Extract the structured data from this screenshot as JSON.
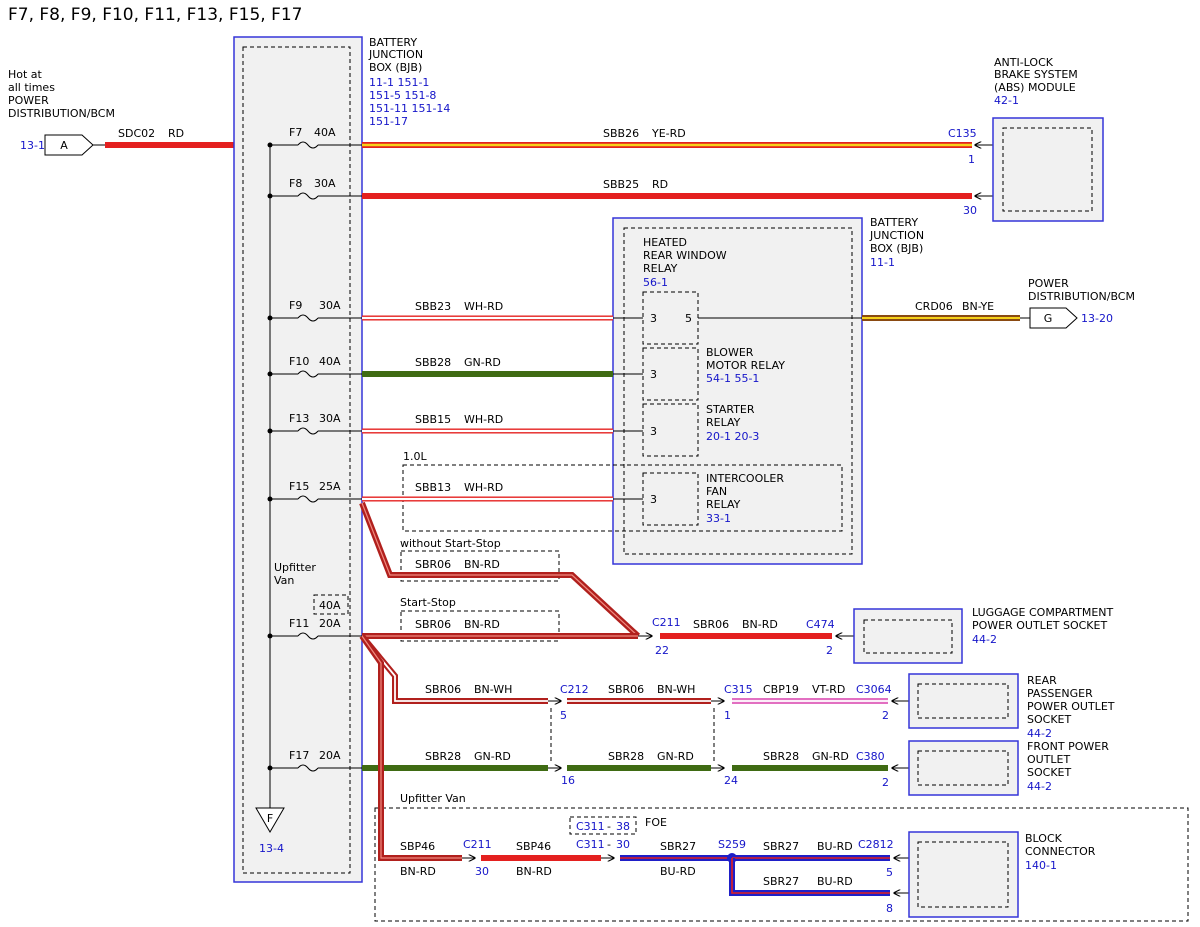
{
  "title": "F7, F8, F9, F10, F11, F13, F15, F17",
  "colors": {
    "red": "#e4201f",
    "dark_red": "#b1201d",
    "yellow": "#f6d21a",
    "green": "#3f6b13",
    "blue": "#1f1fc8",
    "violet": "#e26fc1",
    "brown": "#8a4a12",
    "box_border": "#3535d9",
    "ref_text": "#1515c9"
  },
  "source": {
    "lines": [
      "Hot at",
      "all times",
      "POWER",
      "DISTRIBUTION/BCM"
    ],
    "ref": "13-1",
    "connector": "A",
    "wire": "SDC02",
    "wire_color": "RD"
  },
  "bjb_left": {
    "lines": [
      "BATTERY",
      "JUNCTION",
      "BOX (BJB)"
    ],
    "refs": [
      "11-1    151-1",
      "151-5  151-8",
      "151-11  151-14",
      "151-17"
    ],
    "upfitter": [
      "Upfitter",
      "Van"
    ],
    "ground_label": "F",
    "ground_ref": "13-4"
  },
  "fuses": [
    {
      "name": "F7",
      "rating": "40A"
    },
    {
      "name": "F8",
      "rating": "30A"
    },
    {
      "name": "F9",
      "rating": "30A"
    },
    {
      "name": "F10",
      "rating": "40A"
    },
    {
      "name": "F13",
      "rating": "30A"
    },
    {
      "name": "F15",
      "rating": "25A"
    },
    {
      "name": "F11",
      "rating": "20A",
      "alt": "40A"
    },
    {
      "name": "F17",
      "rating": "20A"
    }
  ],
  "abs": {
    "lines": [
      "ANTI-LOCK",
      "BRAKE SYSTEM",
      "(ABS) MODULE"
    ],
    "ref": "42-1",
    "connector": "C135",
    "pin1": "1",
    "pin2": "30",
    "wire1": "SBB26",
    "wire1_color": "YE-RD",
    "wire2": "SBB25",
    "wire2_color": "RD"
  },
  "bjb_right": {
    "lines": [
      "BATTERY",
      "JUNCTION",
      "BOX (BJB)"
    ],
    "ref": "11-1",
    "relays": [
      {
        "lines": [
          "HEATED",
          "REAR WINDOW",
          "RELAY"
        ],
        "ref": "56-1",
        "pin_in": "3",
        "pin_out": "5"
      },
      {
        "lines": [
          "BLOWER",
          "MOTOR RELAY"
        ],
        "ref": "54-1   55-1",
        "pin_in": "3"
      },
      {
        "lines": [
          "STARTER",
          "RELAY"
        ],
        "ref": "20-1    20-3",
        "pin_in": "3"
      },
      {
        "lines": [
          "INTERCOOLER",
          "FAN",
          "RELAY"
        ],
        "ref": "33-1",
        "pin_in": "3"
      }
    ],
    "option_label": "1.0L"
  },
  "relay_wires": [
    {
      "name": "SBB23",
      "color": "WH-RD"
    },
    {
      "name": "SBB28",
      "color": "GN-RD"
    },
    {
      "name": "SBB15",
      "color": "WH-RD"
    },
    {
      "name": "SBB13",
      "color": "WH-RD"
    }
  ],
  "pdbcm_out": {
    "wire": "CRD06",
    "wire_color": "BN-YE",
    "lines": [
      "POWER",
      "DISTRIBUTION/BCM"
    ],
    "connector": "G",
    "ref": "13-20"
  },
  "startstop": {
    "without_label": "without Start-Stop",
    "with_label": "Start-Stop",
    "wire": "SBR06",
    "wire_color": "BN-RD"
  },
  "luggage": {
    "c_in": "C211",
    "pin_in": "22",
    "wire": "SBR06",
    "wire_color": "BN-RD",
    "connector": "C474",
    "pin": "2",
    "lines": [
      "LUGGAGE COMPARTMENT",
      "POWER OUTLET SOCKET"
    ],
    "ref": "44-2"
  },
  "rear_outlet": {
    "wire1": "SBR06",
    "wire1_color": "BN-WH",
    "c1": "C212",
    "p1": "5",
    "wire2": "SBR06",
    "wire2_color": "BN-WH",
    "c2": "C315",
    "p2": "1",
    "wire3": "CBP19",
    "wire3_color": "VT-RD",
    "connector": "C3064",
    "pin": "2",
    "lines": [
      "REAR",
      "PASSENGER",
      "POWER OUTLET",
      "SOCKET"
    ],
    "ref": "44-2"
  },
  "front_outlet": {
    "wire": "SBR28",
    "wire_color": "GN-RD",
    "p1": "16",
    "p2": "24",
    "connector": "C380",
    "pin": "2",
    "lines": [
      "FRONT POWER",
      "OUTLET",
      "SOCKET"
    ],
    "ref": "44-2"
  },
  "block": {
    "upfitter_label": "Upfitter Van",
    "wire1": "SBP46",
    "wire1_color": "BN-RD",
    "c1": "C211",
    "p1": "30",
    "wire2": "SBP46",
    "wire2_color": "BN-RD",
    "c2": "C311",
    "p2": "30",
    "c2_alt": "C311",
    "p2_alt": "38",
    "foe": "FOE",
    "wire3": "SBR27",
    "wire3_color": "BU-RD",
    "splice": "S259",
    "wire4": "SBR27",
    "wire4_color": "BU-RD",
    "wire5": "SBR27",
    "wire5_color": "BU-RD",
    "connector": "C2812",
    "pin_a": "5",
    "pin_b": "8",
    "lines": [
      "BLOCK",
      "CONNECTOR"
    ],
    "ref": "140-1"
  }
}
